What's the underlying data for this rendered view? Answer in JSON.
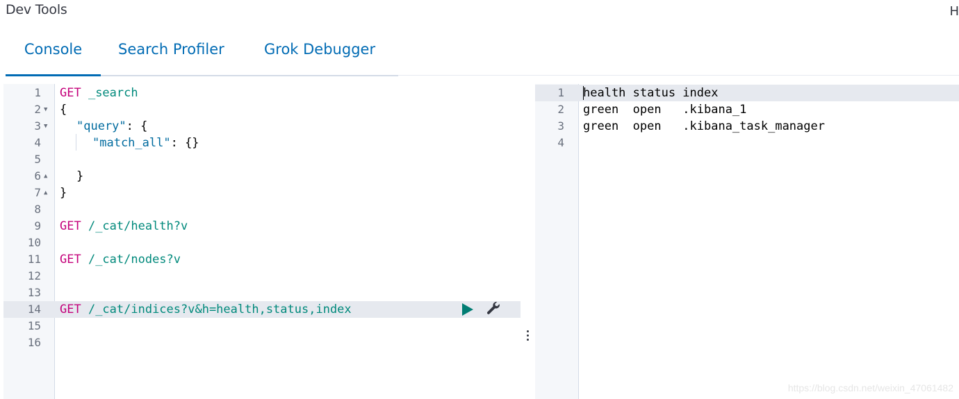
{
  "app": {
    "title": "Dev Tools",
    "help_link": "H"
  },
  "tabs": [
    {
      "label": "Console",
      "active": true
    },
    {
      "label": "Search Profiler",
      "active": false
    },
    {
      "label": "Grok Debugger",
      "active": false
    }
  ],
  "request_editor": {
    "line_numbers": [
      "1",
      "2",
      "3",
      "4",
      "5",
      "6",
      "7",
      "8",
      "9",
      "10",
      "11",
      "12",
      "13",
      "14",
      "15",
      "16"
    ],
    "lines": {
      "l1": {
        "method": "GET",
        "path": " _search"
      },
      "l2": {
        "text": "{"
      },
      "l3": {
        "key": "\"query\"",
        "rest": ": {"
      },
      "l4": {
        "key": "\"match_all\"",
        "rest": ": {}"
      },
      "l6": {
        "text": "}"
      },
      "l7": {
        "text": "}"
      },
      "l9": {
        "method": "GET",
        "path": " /_cat/health?v"
      },
      "l11": {
        "method": "GET",
        "path": " /_cat/nodes?v"
      },
      "l14": {
        "method": "GET",
        "path": " /_cat/indices?v&h=health,status,index"
      }
    },
    "active_line": 14,
    "actions": {
      "run": "play-icon",
      "settings": "wrench-icon"
    }
  },
  "response_output": {
    "line_numbers": [
      "1",
      "2",
      "3",
      "4"
    ],
    "lines": [
      "health status index",
      "green  open   .kibana_1",
      "green  open   .kibana_task_manager",
      ""
    ]
  },
  "watermark": "https://blog.csdn.net/weixin_47061482",
  "colors": {
    "accent": "#006bb4",
    "method": "#c4007a",
    "path": "#00897b",
    "run": "#017d73"
  }
}
